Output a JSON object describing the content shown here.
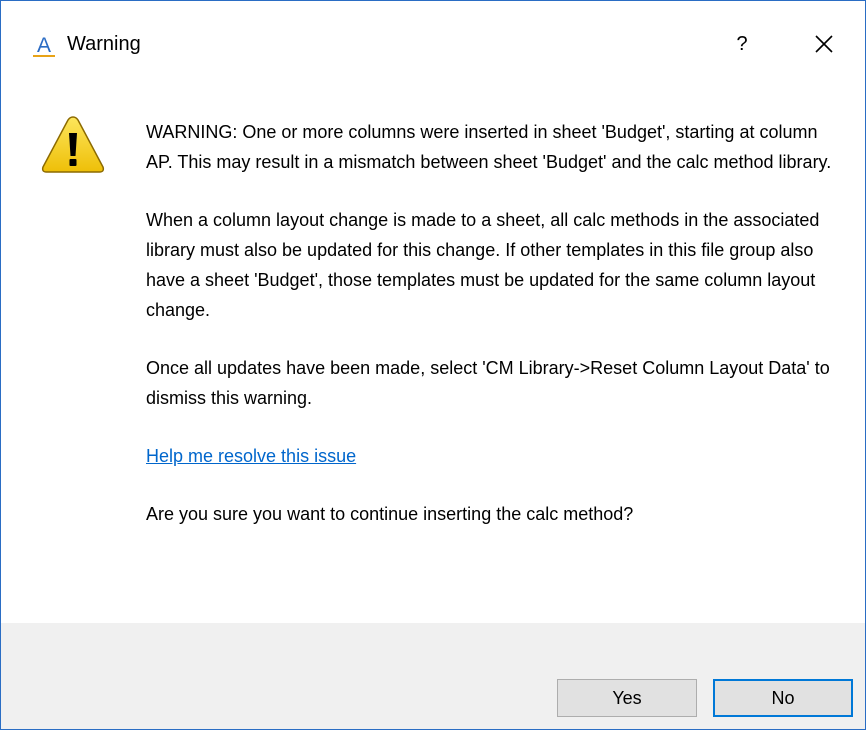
{
  "window": {
    "title": "Warning",
    "app_icon": "app-a-icon",
    "help_label": "?",
    "close_icon": "close-icon"
  },
  "message": {
    "icon": "warning-icon",
    "paragraph1": "WARNING: One or more columns were inserted in sheet 'Budget', starting at column AP. This may result in a mismatch between sheet 'Budget' and the calc method library.",
    "paragraph2": "When a column layout change is made to a sheet, all calc methods in the associated library must also be updated for this change. If other templates in this file group also have a sheet 'Budget', those templates must be updated for the same column layout change.",
    "paragraph3": "Once all updates have been made, select 'CM Library->Reset Column Layout Data' to dismiss this warning.",
    "help_link": "Help me resolve this issue",
    "question": "Are you sure you want to continue inserting the calc method?"
  },
  "buttons": {
    "yes": "Yes",
    "no": "No"
  },
  "colors": {
    "window_border": "#2a6dc4",
    "link": "#0066cc",
    "footer_bg": "#f0f0f0",
    "default_button_border": "#0078d7",
    "warning_yellow": "#f5d10d"
  }
}
